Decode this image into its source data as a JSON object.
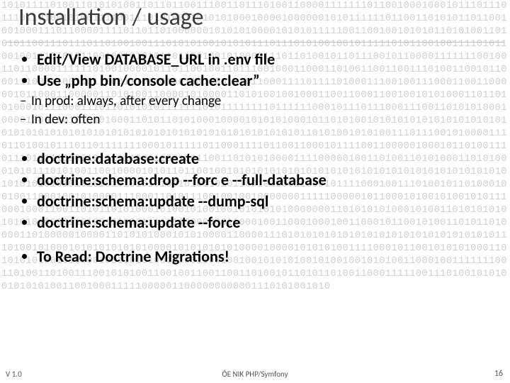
{
  "title": "Installation / usage",
  "bullets_1": [
    "Edit/View DATABASE_URL in .env file",
    "Use „php bin/console cache:clear”"
  ],
  "sub_1": [
    "In prod: always, after every change",
    "In dev: often"
  ],
  "bullets_2": [
    "doctrine:database:create",
    "doctrine:schema:drop --forc e --full-database",
    "doctrine:schema:update  --dump-sql",
    "doctrine:schema:update  --force"
  ],
  "bullets_3": [
    "To Read: Doctrine Migrations!"
  ],
  "footer": {
    "left": "V 1.0",
    "center": "ÓE NIK PHP/Symfony",
    "right": "16"
  },
  "bg_bits": "10101111010011010101001101101100111001101110100110000111111101100100010001011101110111011010010100111100111010100110101010001000010000001010111111011001101010110110010010001110110000111101101101000000101010100001010101111100110010010101011010100110101011001110111011010010011101010100101010111011101010010010111110101100100111101011001001110101011001001010101101100100101000011101101001011011100101100001111111001001101100001111110100100001011011001001101110010001100011010011001100111010011001011000111000110011011000111011010011010001010110001111011110100011100100111000110011000001011000110000011010100110000101000011010100100100011001100011001001010100011011010100010111000111011010101011111110101111111101111110001011101110001110011010101000100001000100101010100011010110101000100001010101000101101010010101010101010101010101010101010101010101010101010101010101010101010101011010100101010011101110010100001110110100101110110111111100010111110110001111011001100010111100110000010001011010011101110111110000101111110011100100110011010101000011110000010011010011010100011010100010101110101001100100001010110110010010101010101010101010101010101010101010101010101010101010101010101010101010010101101011001010001100010111100010011101001011010001001001100010010100001110001101011100100100100000001111100000101100010100101001010111000100011001101011010100010100101001001010101010000000110101010100010100110101010101010101000011010010100011111110000000110001001100010001001100010110010100110101101000011010000010000110101010001010100001100001110101010101010101010101010101010101011101001010001010101010101000010101010101000010000101010100111100010110010101010001101010101001010000100110101001010011001001001010101001010010010101001100010011111110011010011010011100101010011001001100110011010010110101101001100011111001110100101010010101010011001000111110000011000000000001110101001010"
}
